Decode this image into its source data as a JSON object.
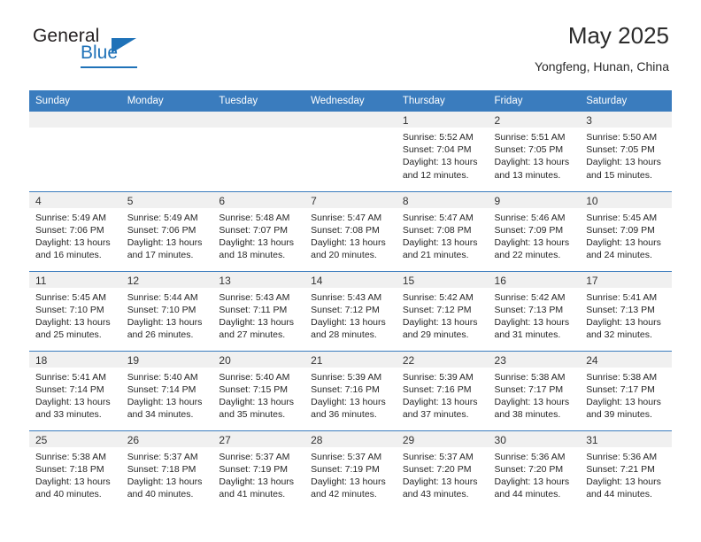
{
  "brand": {
    "name_top": "General",
    "name_bottom": "Blue",
    "accent_color": "#1f72b8"
  },
  "header": {
    "title": "May 2025",
    "subtitle": "Yongfeng, Hunan, China"
  },
  "calendar": {
    "header_bg": "#3a7cbe",
    "daynum_bg": "#f0f0f0",
    "weekday_headers": [
      "Sunday",
      "Monday",
      "Tuesday",
      "Wednesday",
      "Thursday",
      "Friday",
      "Saturday"
    ],
    "labels": {
      "sunrise": "Sunrise:",
      "sunset": "Sunset:",
      "daylight": "Daylight:"
    },
    "weeks": [
      [
        {
          "day": "",
          "empty": true
        },
        {
          "day": "",
          "empty": true
        },
        {
          "day": "",
          "empty": true
        },
        {
          "day": "",
          "empty": true
        },
        {
          "day": "1",
          "sunrise": "Sunrise: 5:52 AM",
          "sunset": "Sunset: 7:04 PM",
          "daylight_1": "Daylight: 13 hours",
          "daylight_2": "and 12 minutes."
        },
        {
          "day": "2",
          "sunrise": "Sunrise: 5:51 AM",
          "sunset": "Sunset: 7:05 PM",
          "daylight_1": "Daylight: 13 hours",
          "daylight_2": "and 13 minutes."
        },
        {
          "day": "3",
          "sunrise": "Sunrise: 5:50 AM",
          "sunset": "Sunset: 7:05 PM",
          "daylight_1": "Daylight: 13 hours",
          "daylight_2": "and 15 minutes."
        }
      ],
      [
        {
          "day": "4",
          "sunrise": "Sunrise: 5:49 AM",
          "sunset": "Sunset: 7:06 PM",
          "daylight_1": "Daylight: 13 hours",
          "daylight_2": "and 16 minutes."
        },
        {
          "day": "5",
          "sunrise": "Sunrise: 5:49 AM",
          "sunset": "Sunset: 7:06 PM",
          "daylight_1": "Daylight: 13 hours",
          "daylight_2": "and 17 minutes."
        },
        {
          "day": "6",
          "sunrise": "Sunrise: 5:48 AM",
          "sunset": "Sunset: 7:07 PM",
          "daylight_1": "Daylight: 13 hours",
          "daylight_2": "and 18 minutes."
        },
        {
          "day": "7",
          "sunrise": "Sunrise: 5:47 AM",
          "sunset": "Sunset: 7:08 PM",
          "daylight_1": "Daylight: 13 hours",
          "daylight_2": "and 20 minutes."
        },
        {
          "day": "8",
          "sunrise": "Sunrise: 5:47 AM",
          "sunset": "Sunset: 7:08 PM",
          "daylight_1": "Daylight: 13 hours",
          "daylight_2": "and 21 minutes."
        },
        {
          "day": "9",
          "sunrise": "Sunrise: 5:46 AM",
          "sunset": "Sunset: 7:09 PM",
          "daylight_1": "Daylight: 13 hours",
          "daylight_2": "and 22 minutes."
        },
        {
          "day": "10",
          "sunrise": "Sunrise: 5:45 AM",
          "sunset": "Sunset: 7:09 PM",
          "daylight_1": "Daylight: 13 hours",
          "daylight_2": "and 24 minutes."
        }
      ],
      [
        {
          "day": "11",
          "sunrise": "Sunrise: 5:45 AM",
          "sunset": "Sunset: 7:10 PM",
          "daylight_1": "Daylight: 13 hours",
          "daylight_2": "and 25 minutes."
        },
        {
          "day": "12",
          "sunrise": "Sunrise: 5:44 AM",
          "sunset": "Sunset: 7:10 PM",
          "daylight_1": "Daylight: 13 hours",
          "daylight_2": "and 26 minutes."
        },
        {
          "day": "13",
          "sunrise": "Sunrise: 5:43 AM",
          "sunset": "Sunset: 7:11 PM",
          "daylight_1": "Daylight: 13 hours",
          "daylight_2": "and 27 minutes."
        },
        {
          "day": "14",
          "sunrise": "Sunrise: 5:43 AM",
          "sunset": "Sunset: 7:12 PM",
          "daylight_1": "Daylight: 13 hours",
          "daylight_2": "and 28 minutes."
        },
        {
          "day": "15",
          "sunrise": "Sunrise: 5:42 AM",
          "sunset": "Sunset: 7:12 PM",
          "daylight_1": "Daylight: 13 hours",
          "daylight_2": "and 29 minutes."
        },
        {
          "day": "16",
          "sunrise": "Sunrise: 5:42 AM",
          "sunset": "Sunset: 7:13 PM",
          "daylight_1": "Daylight: 13 hours",
          "daylight_2": "and 31 minutes."
        },
        {
          "day": "17",
          "sunrise": "Sunrise: 5:41 AM",
          "sunset": "Sunset: 7:13 PM",
          "daylight_1": "Daylight: 13 hours",
          "daylight_2": "and 32 minutes."
        }
      ],
      [
        {
          "day": "18",
          "sunrise": "Sunrise: 5:41 AM",
          "sunset": "Sunset: 7:14 PM",
          "daylight_1": "Daylight: 13 hours",
          "daylight_2": "and 33 minutes."
        },
        {
          "day": "19",
          "sunrise": "Sunrise: 5:40 AM",
          "sunset": "Sunset: 7:14 PM",
          "daylight_1": "Daylight: 13 hours",
          "daylight_2": "and 34 minutes."
        },
        {
          "day": "20",
          "sunrise": "Sunrise: 5:40 AM",
          "sunset": "Sunset: 7:15 PM",
          "daylight_1": "Daylight: 13 hours",
          "daylight_2": "and 35 minutes."
        },
        {
          "day": "21",
          "sunrise": "Sunrise: 5:39 AM",
          "sunset": "Sunset: 7:16 PM",
          "daylight_1": "Daylight: 13 hours",
          "daylight_2": "and 36 minutes."
        },
        {
          "day": "22",
          "sunrise": "Sunrise: 5:39 AM",
          "sunset": "Sunset: 7:16 PM",
          "daylight_1": "Daylight: 13 hours",
          "daylight_2": "and 37 minutes."
        },
        {
          "day": "23",
          "sunrise": "Sunrise: 5:38 AM",
          "sunset": "Sunset: 7:17 PM",
          "daylight_1": "Daylight: 13 hours",
          "daylight_2": "and 38 minutes."
        },
        {
          "day": "24",
          "sunrise": "Sunrise: 5:38 AM",
          "sunset": "Sunset: 7:17 PM",
          "daylight_1": "Daylight: 13 hours",
          "daylight_2": "and 39 minutes."
        }
      ],
      [
        {
          "day": "25",
          "sunrise": "Sunrise: 5:38 AM",
          "sunset": "Sunset: 7:18 PM",
          "daylight_1": "Daylight: 13 hours",
          "daylight_2": "and 40 minutes."
        },
        {
          "day": "26",
          "sunrise": "Sunrise: 5:37 AM",
          "sunset": "Sunset: 7:18 PM",
          "daylight_1": "Daylight: 13 hours",
          "daylight_2": "and 40 minutes."
        },
        {
          "day": "27",
          "sunrise": "Sunrise: 5:37 AM",
          "sunset": "Sunset: 7:19 PM",
          "daylight_1": "Daylight: 13 hours",
          "daylight_2": "and 41 minutes."
        },
        {
          "day": "28",
          "sunrise": "Sunrise: 5:37 AM",
          "sunset": "Sunset: 7:19 PM",
          "daylight_1": "Daylight: 13 hours",
          "daylight_2": "and 42 minutes."
        },
        {
          "day": "29",
          "sunrise": "Sunrise: 5:37 AM",
          "sunset": "Sunset: 7:20 PM",
          "daylight_1": "Daylight: 13 hours",
          "daylight_2": "and 43 minutes."
        },
        {
          "day": "30",
          "sunrise": "Sunrise: 5:36 AM",
          "sunset": "Sunset: 7:20 PM",
          "daylight_1": "Daylight: 13 hours",
          "daylight_2": "and 44 minutes."
        },
        {
          "day": "31",
          "sunrise": "Sunrise: 5:36 AM",
          "sunset": "Sunset: 7:21 PM",
          "daylight_1": "Daylight: 13 hours",
          "daylight_2": "and 44 minutes."
        }
      ]
    ]
  }
}
